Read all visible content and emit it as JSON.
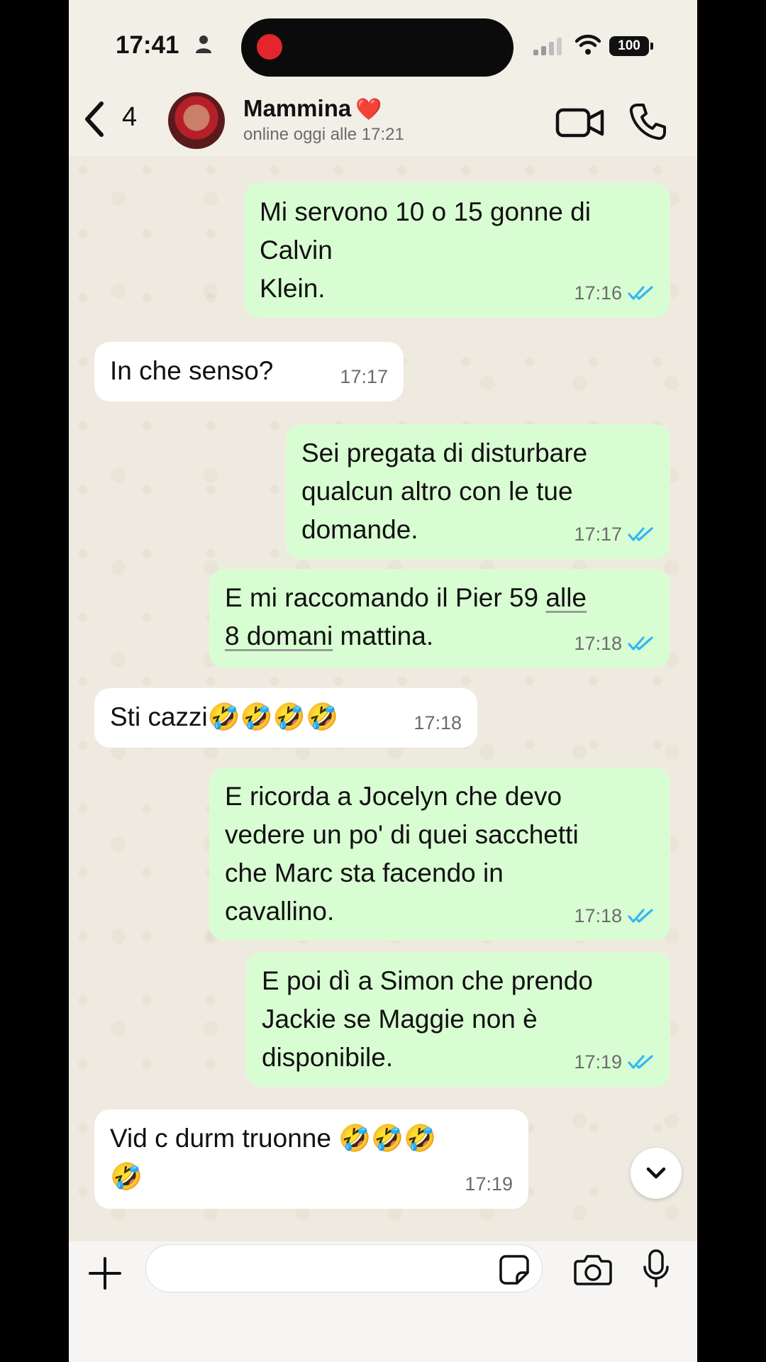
{
  "status_bar": {
    "time": "17:41",
    "battery": "100"
  },
  "header": {
    "back_count": "4",
    "contact_name": "Mammina",
    "contact_emoji": "❤️",
    "contact_status": "online oggi alle 17:21"
  },
  "messages": [
    {
      "dir": "out",
      "lines": [
        "Mi servono 10 o 15 gonne di",
        "Calvin",
        "Klein."
      ],
      "time": "17:16",
      "read": true
    },
    {
      "dir": "in",
      "text": "In che senso?",
      "time": "17:17"
    },
    {
      "dir": "out",
      "lines": [
        "Sei pregata di disturbare",
        "qualcun altro con le tue",
        "domande."
      ],
      "time": "17:17",
      "read": true
    },
    {
      "dir": "out",
      "line1_a": "E mi raccomando il Pier 59 ",
      "line1_link": "alle",
      "line2_link": "8 domani",
      "line2_b": " mattina.",
      "time": "17:18",
      "read": true
    },
    {
      "dir": "in",
      "text": "Sti cazzi🤣🤣🤣🤣",
      "time": "17:18"
    },
    {
      "dir": "out",
      "lines": [
        "E ricorda a Jocelyn che devo",
        "vedere un po' di quei sacchetti",
        "che Marc sta facendo in",
        "cavallino."
      ],
      "time": "17:18",
      "read": true
    },
    {
      "dir": "out",
      "lines": [
        "E poi dì a Simon che prendo",
        "Jackie se Maggie non è",
        "disponibile."
      ],
      "time": "17:19",
      "read": true
    },
    {
      "dir": "in",
      "lines": [
        "Vid c durm  truonne 🤣🤣🤣",
        "🤣"
      ],
      "time": "17:19"
    }
  ],
  "composer": {
    "placeholder": ""
  },
  "colors": {
    "outgoing_bubble": "#d9fdd3",
    "incoming_bubble": "#ffffff",
    "read_ticks": "#34b7f1",
    "chat_bg": "#efeae0"
  },
  "icons": {
    "back": "chevron-left-icon",
    "video": "video-camera-icon",
    "call": "phone-icon",
    "attach": "plus-icon",
    "sticker": "sticker-icon",
    "camera": "camera-icon",
    "mic": "microphone-icon",
    "scroll": "chevron-down-icon"
  }
}
